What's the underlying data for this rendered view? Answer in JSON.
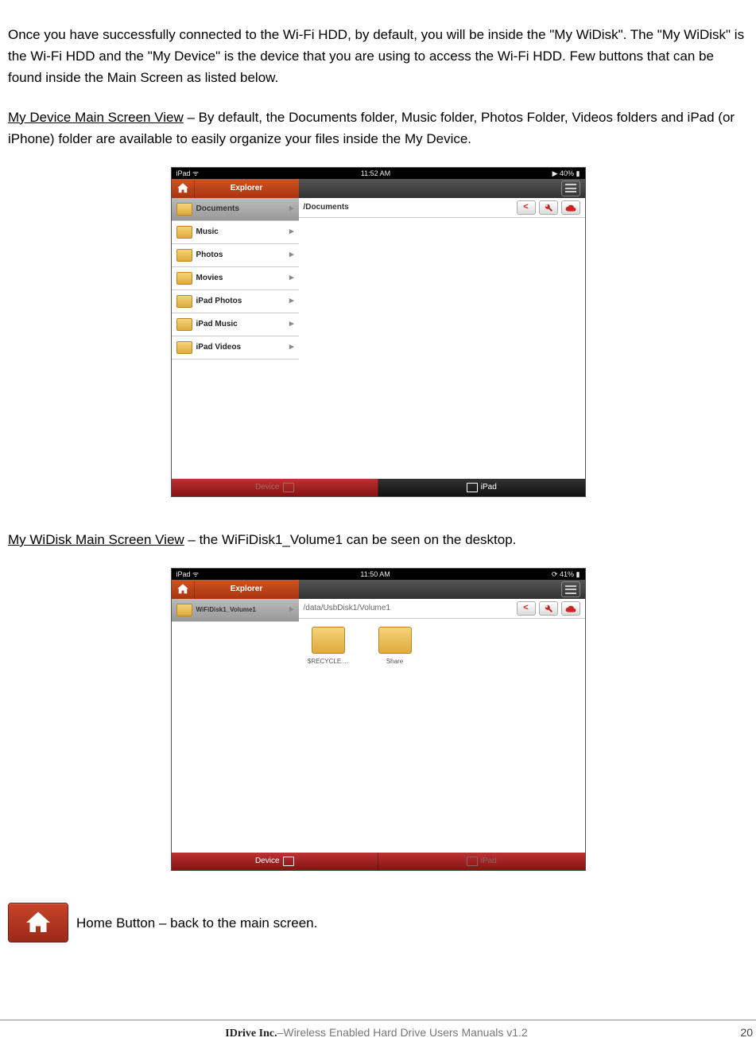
{
  "intro": "Once you have successfully connected to the Wi-Fi HDD, by default, you will be inside the \"My WiDisk\". The \"My WiDisk\" is the Wi-Fi HDD and the \"My Device\" is the device that you are using to access the Wi-Fi HDD.   Few buttons that can be found inside the Main Screen as listed below.",
  "section1": {
    "heading": "My Device Main Screen View",
    "desc": " – By default, the Documents folder, Music folder, Photos Folder, Videos folders and iPad (or iPhone) folder are available to easily organize your files inside the My Device."
  },
  "shot1": {
    "status_left": "iPad",
    "status_time": "11:52 AM",
    "status_right": "40%",
    "explorer": "Explorer",
    "path": "/Documents",
    "sidebar": [
      "Documents",
      "Music",
      "Photos",
      "Movies",
      "iPad Photos",
      "iPad Music",
      "iPad Videos"
    ],
    "tab_device": "Device",
    "tab_ipad": "iPad"
  },
  "section2": {
    "heading": "My WiDisk Main Screen View",
    "desc": " – the WiFiDisk1_Volume1 can be seen on the desktop."
  },
  "shot2": {
    "status_left": "iPad",
    "status_time": "11:50 AM",
    "status_right": "41%",
    "explorer": "Explorer",
    "path": "/data/UsbDisk1/Volume1",
    "sidebar_sel": "WiFiDisk1_Volume1",
    "icons": [
      "$RECYCLE....",
      "Share"
    ],
    "tab_device": "Device",
    "tab_ipad": "iPad"
  },
  "home_caption": " Home Button – back to the main screen.",
  "footer": {
    "company": "IDrive Inc.",
    "product": "–Wireless Enabled Hard Drive   Users Manuals v1.2",
    "page": "20"
  }
}
